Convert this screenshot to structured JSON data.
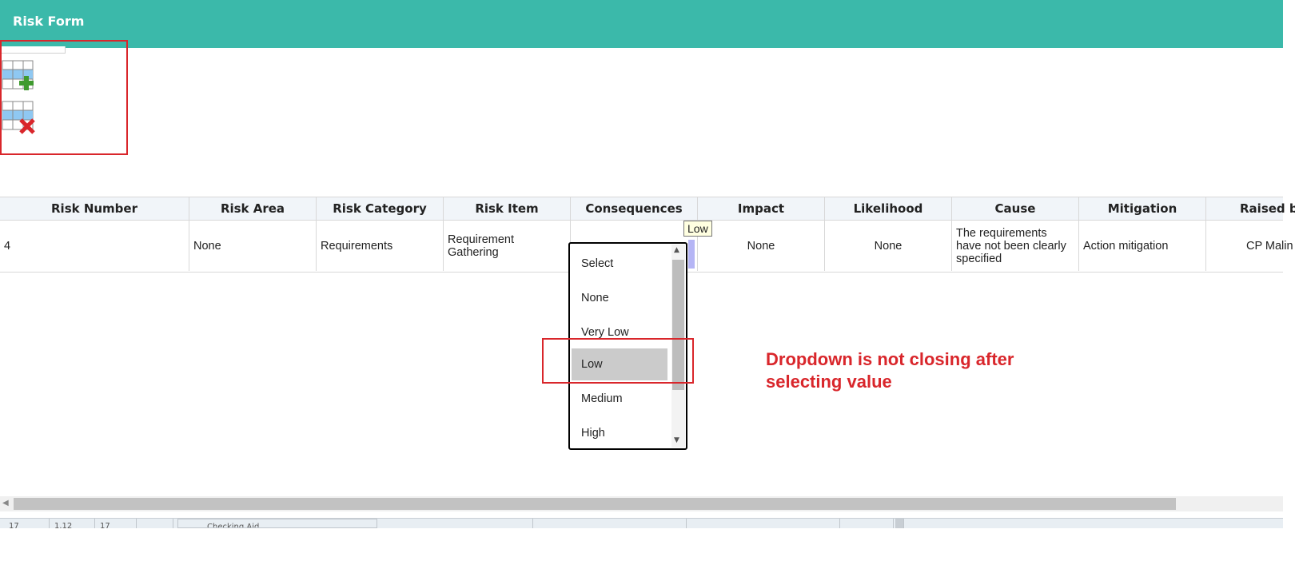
{
  "header": {
    "title": "Risk Form"
  },
  "colors": {
    "header_bg": "#3bb9aa",
    "annotation": "#d9262b",
    "selected_option_bg": "#cbcbcb"
  },
  "toolbar": {
    "icons": [
      "add-row-icon",
      "delete-row-icon"
    ]
  },
  "table": {
    "columns": [
      "Risk Number",
      "Risk Area",
      "Risk Category",
      "Risk Item",
      "Consequences",
      "Impact",
      "Likelihood",
      "Cause",
      "Mitigation",
      "Raised b"
    ],
    "rows": [
      {
        "risk_number": "4",
        "risk_area": "None",
        "risk_category": "Requirements",
        "risk_item": "Requirement Gathering",
        "consequences": "",
        "impact": "None",
        "likelihood": "None",
        "cause": "The requirements have not been clearly specified",
        "mitigation": "Action mitigation",
        "raised_by": "CP Malin"
      }
    ]
  },
  "tooltip": "Low",
  "dropdown": {
    "options": [
      "Select",
      "None",
      "Very Low",
      "Low",
      "Medium",
      "High"
    ],
    "selected": "Low"
  },
  "annotation": {
    "text": "Dropdown is not closing after\nselecting value"
  },
  "statusbar": {
    "segments": [
      "17",
      "1.12",
      "17",
      "",
      "Checking Aid"
    ]
  }
}
